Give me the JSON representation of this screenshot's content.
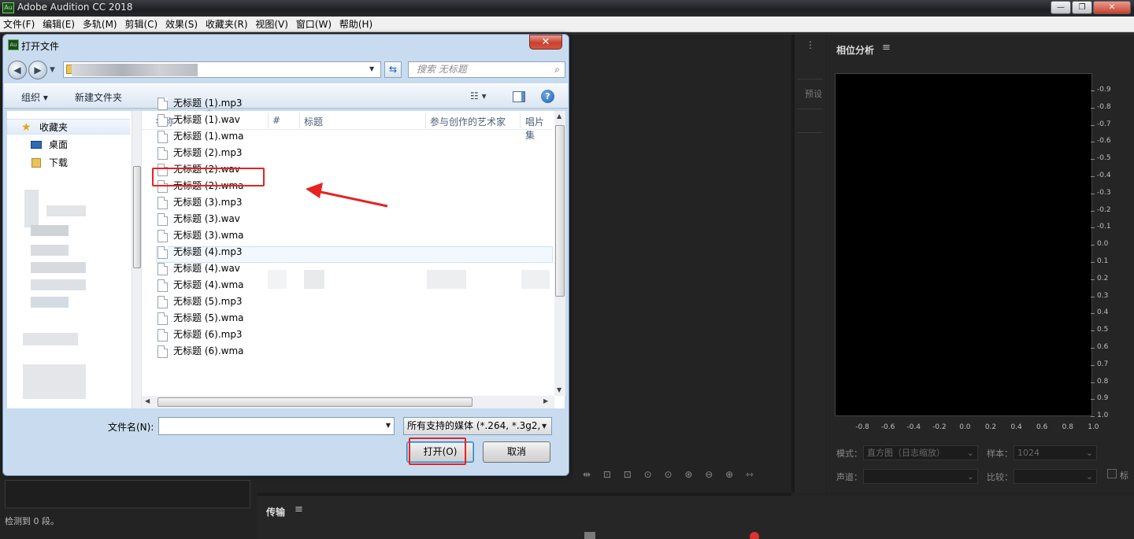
{
  "app": {
    "title": "Adobe Audition CC 2018",
    "icon_text": "Au",
    "menus": [
      "文件(F)",
      "编辑(E)",
      "多轨(M)",
      "剪辑(C)",
      "效果(S)",
      "收藏夹(R)",
      "视图(V)",
      "窗口(W)",
      "帮助(H)"
    ]
  },
  "phase_panel": {
    "title": "相位分析",
    "y_ticks": [
      "0.9",
      "0.8",
      "0.7",
      "0.6",
      "0.5",
      "0.4",
      "0.3",
      "0.2",
      "0.1",
      "0.0",
      "0.1",
      "0.2",
      "0.3",
      "0.4",
      "0.5",
      "0.6",
      "0.7",
      "0.8",
      "0.9",
      "1.0"
    ],
    "y_ticks_display": [
      "-0.9",
      "-0.8",
      "-0.7",
      "-0.6",
      "-0.5",
      "-0.4",
      "-0.3",
      "-0.2",
      "-0.1",
      "0.0",
      "0.1",
      "0.2",
      "0.3",
      "0.4",
      "0.5",
      "0.6",
      "0.7",
      "0.8",
      "0.9",
      "1.0"
    ],
    "x_ticks": [
      "-0.8",
      "-0.6",
      "-0.4",
      "-0.2",
      "0.0",
      "0.2",
      "0.4",
      "0.6",
      "0.8",
      "1.0"
    ],
    "mode_label": "模式：",
    "mode_value": "直方图（日志缩放）",
    "samples_label": "样本：",
    "samples_value": "1024",
    "channel_label": "声道：",
    "compare_label": "比较：",
    "extra_label": "标"
  },
  "presets_label": "预设",
  "transport": {
    "title": "传输"
  },
  "left_status": "检测到 0 段。",
  "dialog": {
    "title": "打开文件",
    "icon_text": "Au",
    "close": "✕",
    "search_placeholder": "搜索 无标题",
    "organize": "组织 ▾",
    "new_folder": "新建文件夹",
    "nav": {
      "favorites": "收藏夹",
      "desktop": "桌面",
      "downloads": "下载"
    },
    "columns": [
      "名称",
      "#",
      "标题",
      "参与创作的艺术家",
      "唱片集"
    ],
    "files": [
      "无标题 (1).mp3",
      "无标题 (1).wav",
      "无标题 (1).wma",
      "无标题 (2).mp3",
      "无标题 (2).wav",
      "无标题 (2).wma",
      "无标题 (3).mp3",
      "无标题 (3).wav",
      "无标题 (3).wma",
      "无标题 (4).mp3",
      "无标题 (4).wav",
      "无标题 (4).wma",
      "无标题 (5).mp3",
      "无标题 (5).wma",
      "无标题 (6).mp3",
      "无标题 (6).wma"
    ],
    "filename_label": "文件名(N):",
    "filename_value": "",
    "filter_value": "所有支持的媒体 (*.264, *.3g2,",
    "open_button": "打开(O)",
    "cancel_button": "取消",
    "help": "?"
  },
  "colors": {
    "annotation": "#e52323",
    "app_bg": "#232323"
  }
}
